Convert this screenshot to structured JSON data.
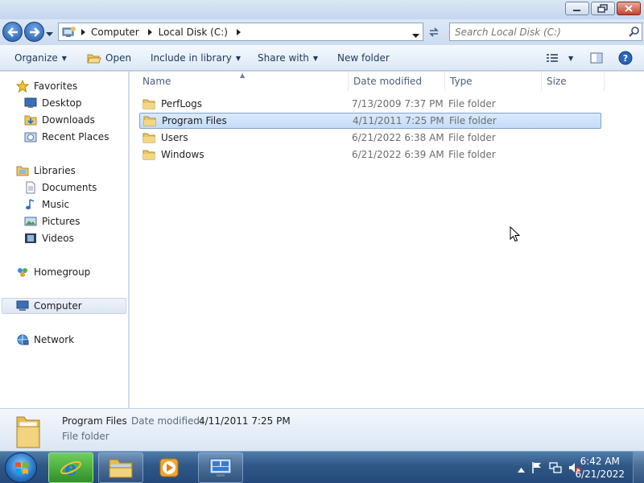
{
  "window": {
    "minimize_icon": "minimize-icon",
    "maximize_icon": "restore-icon",
    "close_icon": "close-icon"
  },
  "address": {
    "crumbs": [
      "Computer",
      "Local Disk (C:)"
    ],
    "search_placeholder": "Search Local Disk (C:)"
  },
  "toolbar": {
    "organize": "Organize",
    "open": "Open",
    "include_in_library": "Include in library",
    "share_with": "Share with",
    "new_folder": "New folder"
  },
  "navigation": {
    "favorites": "Favorites",
    "favorites_items": [
      "Desktop",
      "Downloads",
      "Recent Places"
    ],
    "libraries": "Libraries",
    "library_items": [
      "Documents",
      "Music",
      "Pictures",
      "Videos"
    ],
    "homegroup": "Homegroup",
    "computer": "Computer",
    "network": "Network"
  },
  "columns": {
    "name": "Name",
    "date_modified": "Date modified",
    "type": "Type",
    "size": "Size"
  },
  "files": [
    {
      "name": "PerfLogs",
      "date": "7/13/2009 7:37 PM",
      "type": "File folder",
      "selected": false
    },
    {
      "name": "Program Files",
      "date": "4/11/2011 7:25 PM",
      "type": "File folder",
      "selected": true
    },
    {
      "name": "Users",
      "date": "6/21/2022 6:38 AM",
      "type": "File folder",
      "selected": false
    },
    {
      "name": "Windows",
      "date": "6/21/2022 6:39 AM",
      "type": "File folder",
      "selected": false
    }
  ],
  "details": {
    "name": "Program Files",
    "date_label": "Date modified:",
    "date_value": "4/11/2011 7:25 PM",
    "type": "File folder"
  },
  "taskbar": {
    "time": "6:42 AM",
    "date": "6/21/2022"
  }
}
